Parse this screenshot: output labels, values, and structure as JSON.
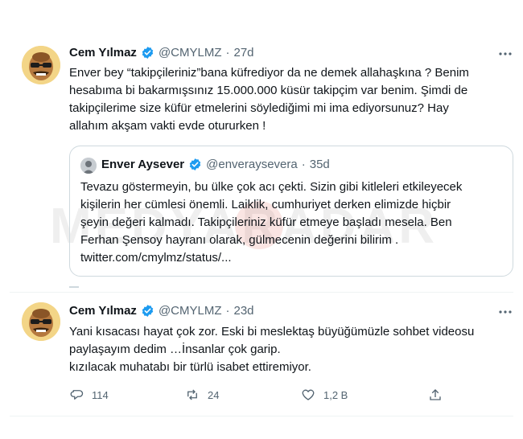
{
  "tweets": [
    {
      "name": "Cem Yılmaz",
      "handle": "@CMYLMZ",
      "sep": "·",
      "time": "27d",
      "lines": [
        "Enver bey “takipçileriniz”bana küfrediyor da ne demek allahaşkına ? Benim",
        "hesabıma bi bakarmışsınız 15.000.000 küsür takipçim var benim. Şimdi de",
        "takipçilerime size küfür etmelerini söylediğimi mi ima ediyorsunuz? Hay",
        "allahım akşam vakti evde otururken !"
      ]
    },
    {
      "name": "Cem Yılmaz",
      "handle": "@CMYLMZ",
      "sep": "·",
      "time": "23d",
      "lines": [
        "Yani kısacası hayat çok zor. Eski bi meslektaş büyüğümüzle sohbet videosu",
        "paylaşayım dedim …İnsanlar çok garip.",
        "kızılacak  muhatabı bir türlü isabet ettiremiyor."
      ]
    }
  ],
  "quote": {
    "name": "Enver Aysever",
    "handle": "@enveraysevera",
    "sep": "·",
    "time": "35d",
    "lines": [
      "Tevazu göstermeyin, bu ülke çok acı çekti. Sizin gibi kitleleri etkileyecek",
      "kişilerin her cümlesi önemli. Laiklik, cumhuriyet derken elimizde hiçbir",
      "şeyin değeri kalmadı. Takipçileriniz küfür etmeye başladı mesela. Ben",
      "Ferhan Şensoy hayranı olarak, gülmecenin değerini bilirim .",
      "twitter.com/cmylmz/status/..."
    ]
  },
  "actions": {
    "reply_count": "114",
    "retweet_count": "24",
    "like_count": "1,2 B"
  },
  "watermark": "MEDYARADAR",
  "colors": {
    "verified": "#1d9bf0",
    "muted": "#536471",
    "watermark_red": "#d9463a"
  }
}
